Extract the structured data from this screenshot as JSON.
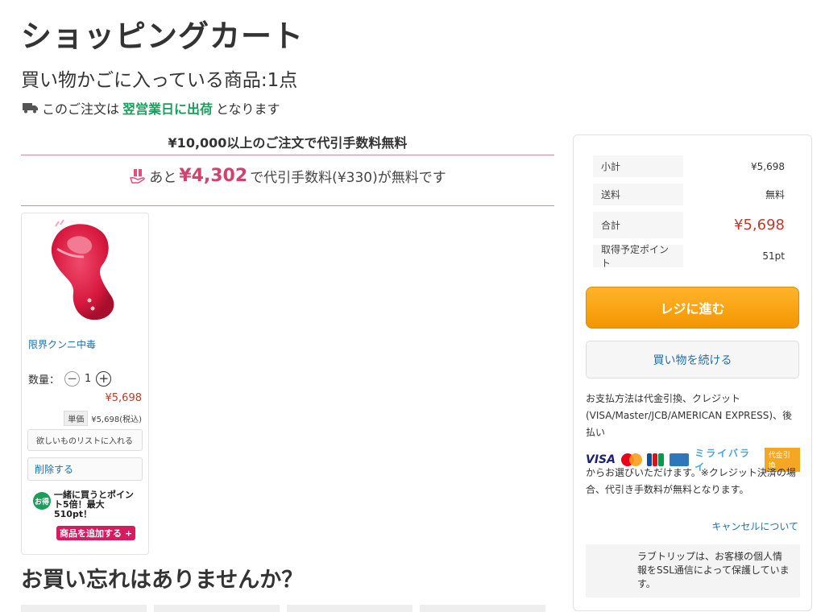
{
  "page": {
    "title": "ショッピングカート",
    "cart_count": "買い物かごに入っている商品:1点"
  },
  "shipping": {
    "prefix": "このご注文は",
    "highlight": "翌営業日に出荷",
    "suffix": "となります"
  },
  "promo": {
    "title": "¥10,000以上のご注文で代引手数料無料",
    "prefix": "あと",
    "amount": "¥4,302",
    "suffix": "で代引手数料(¥330)が無料です"
  },
  "item": {
    "name": "限界クンニ中毒",
    "qty_label": "数量：",
    "qty_value": "1",
    "qty_minus": "−",
    "qty_plus": "+",
    "price": "¥5,698",
    "unit_label": "単価",
    "unit_price": "¥5,698(税込)",
    "wishlist_label": "欲しいものリストに入れる",
    "delete_label": "削除する",
    "bonus_badge": "お得",
    "bonus_text": "一緒に買うとポイント5倍！最大510pt！",
    "add_item_label": "商品を追加する",
    "add_item_icon": "+"
  },
  "recommend": {
    "title": "お買い忘れはありませんか？"
  },
  "summary": {
    "rows": [
      {
        "label": "小計",
        "value": "¥5,698"
      },
      {
        "label": "送料",
        "value": "無料"
      },
      {
        "label": "合計",
        "value": "¥5,698"
      },
      {
        "label": "取得予定ポイント",
        "value": "51pt"
      }
    ],
    "checkout_label": "レジに進む",
    "continue_label": "買い物を続ける",
    "payment_text": "お支払方法は代金引換、クレジット(VISA/Master/JCB/AMERICAN EXPRESS)、後払い",
    "logo_visa": "VISA",
    "logo_miraipay": "ミライバライ",
    "logo_cod": "代金引換",
    "payment_text2": "からお選びいただけます。※クレジット決済の場合、代引き手数料が無料となります。",
    "cancel_link": "キャンセルについて",
    "ssl_text": "ラブトリップは、お客様の個人情報をSSL通信によって保護しています。"
  },
  "colors": {
    "accent_green": "#1a9e5c",
    "price_red": "#c0392b",
    "promo_pink": "#d2426e",
    "checkout_orange": "#f39600",
    "link_blue": "#1f6fb2"
  }
}
